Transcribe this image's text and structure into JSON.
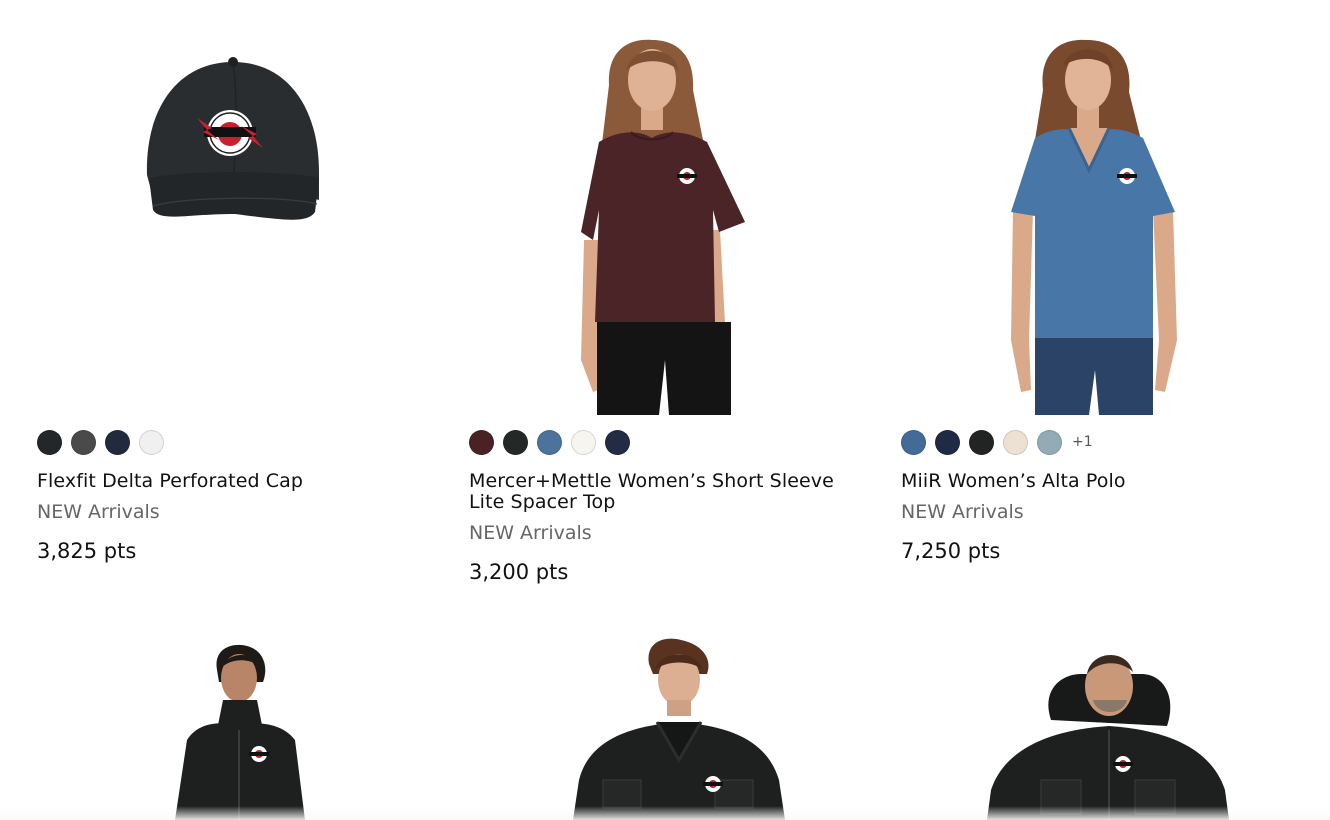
{
  "products": [
    {
      "name": "Flexfit Delta Perforated Cap",
      "category": "NEW Arrivals",
      "price": "3,825 pts",
      "image_icon": "cap-product-image",
      "swatches": [
        "#24272a",
        "#4a4a4a",
        "#222a3d",
        "#f0f0f0"
      ],
      "more_colors": ""
    },
    {
      "name": "Mercer+Mettle Women’s Short Sleeve Lite Spacer Top",
      "category": "NEW Arrivals",
      "price": "3,200 pts",
      "image_icon": "womens-top-product-image",
      "swatches": [
        "#4a2226",
        "#242826",
        "#4b739c",
        "#f6f5f0",
        "#222c44"
      ],
      "more_colors": ""
    },
    {
      "name": "MiiR Women’s Alta Polo",
      "category": "NEW Arrivals",
      "price": "7,250 pts",
      "image_icon": "womens-polo-product-image",
      "swatches": [
        "#446a98",
        "#1f2a44",
        "#212423",
        "#ece1d2",
        "#93abb4"
      ],
      "more_colors": "+1"
    },
    {
      "image_icon": "womens-jacket-product-image"
    },
    {
      "image_icon": "mens-work-jacket-product-image"
    },
    {
      "image_icon": "mens-hooded-jacket-product-image"
    }
  ],
  "colors": {
    "cap": "#2a2d2f",
    "top": "#4a2427",
    "polo": "#4876a6",
    "jacket": "#1e2020",
    "skin": "#d9a98a",
    "hair_light": "#8a5a3a",
    "hair_dark": "#1f1a17",
    "pants_black": "#141414",
    "jeans": "#2a4366",
    "logo_red": "#c8202e"
  }
}
